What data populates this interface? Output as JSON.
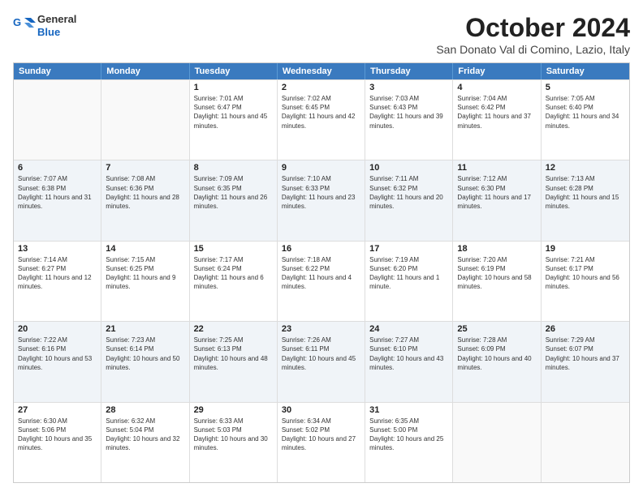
{
  "header": {
    "logo_line1": "General",
    "logo_line2": "Blue",
    "month": "October 2024",
    "location": "San Donato Val di Comino, Lazio, Italy"
  },
  "days_of_week": [
    "Sunday",
    "Monday",
    "Tuesday",
    "Wednesday",
    "Thursday",
    "Friday",
    "Saturday"
  ],
  "weeks": [
    [
      {
        "day": "",
        "empty": true
      },
      {
        "day": "",
        "empty": true
      },
      {
        "day": "1",
        "info": "Sunrise: 7:01 AM\nSunset: 6:47 PM\nDaylight: 11 hours and 45 minutes."
      },
      {
        "day": "2",
        "info": "Sunrise: 7:02 AM\nSunset: 6:45 PM\nDaylight: 11 hours and 42 minutes."
      },
      {
        "day": "3",
        "info": "Sunrise: 7:03 AM\nSunset: 6:43 PM\nDaylight: 11 hours and 39 minutes."
      },
      {
        "day": "4",
        "info": "Sunrise: 7:04 AM\nSunset: 6:42 PM\nDaylight: 11 hours and 37 minutes."
      },
      {
        "day": "5",
        "info": "Sunrise: 7:05 AM\nSunset: 6:40 PM\nDaylight: 11 hours and 34 minutes."
      }
    ],
    [
      {
        "day": "6",
        "info": "Sunrise: 7:07 AM\nSunset: 6:38 PM\nDaylight: 11 hours and 31 minutes."
      },
      {
        "day": "7",
        "info": "Sunrise: 7:08 AM\nSunset: 6:36 PM\nDaylight: 11 hours and 28 minutes."
      },
      {
        "day": "8",
        "info": "Sunrise: 7:09 AM\nSunset: 6:35 PM\nDaylight: 11 hours and 26 minutes."
      },
      {
        "day": "9",
        "info": "Sunrise: 7:10 AM\nSunset: 6:33 PM\nDaylight: 11 hours and 23 minutes."
      },
      {
        "day": "10",
        "info": "Sunrise: 7:11 AM\nSunset: 6:32 PM\nDaylight: 11 hours and 20 minutes."
      },
      {
        "day": "11",
        "info": "Sunrise: 7:12 AM\nSunset: 6:30 PM\nDaylight: 11 hours and 17 minutes."
      },
      {
        "day": "12",
        "info": "Sunrise: 7:13 AM\nSunset: 6:28 PM\nDaylight: 11 hours and 15 minutes."
      }
    ],
    [
      {
        "day": "13",
        "info": "Sunrise: 7:14 AM\nSunset: 6:27 PM\nDaylight: 11 hours and 12 minutes."
      },
      {
        "day": "14",
        "info": "Sunrise: 7:15 AM\nSunset: 6:25 PM\nDaylight: 11 hours and 9 minutes."
      },
      {
        "day": "15",
        "info": "Sunrise: 7:17 AM\nSunset: 6:24 PM\nDaylight: 11 hours and 6 minutes."
      },
      {
        "day": "16",
        "info": "Sunrise: 7:18 AM\nSunset: 6:22 PM\nDaylight: 11 hours and 4 minutes."
      },
      {
        "day": "17",
        "info": "Sunrise: 7:19 AM\nSunset: 6:20 PM\nDaylight: 11 hours and 1 minute."
      },
      {
        "day": "18",
        "info": "Sunrise: 7:20 AM\nSunset: 6:19 PM\nDaylight: 10 hours and 58 minutes."
      },
      {
        "day": "19",
        "info": "Sunrise: 7:21 AM\nSunset: 6:17 PM\nDaylight: 10 hours and 56 minutes."
      }
    ],
    [
      {
        "day": "20",
        "info": "Sunrise: 7:22 AM\nSunset: 6:16 PM\nDaylight: 10 hours and 53 minutes."
      },
      {
        "day": "21",
        "info": "Sunrise: 7:23 AM\nSunset: 6:14 PM\nDaylight: 10 hours and 50 minutes."
      },
      {
        "day": "22",
        "info": "Sunrise: 7:25 AM\nSunset: 6:13 PM\nDaylight: 10 hours and 48 minutes."
      },
      {
        "day": "23",
        "info": "Sunrise: 7:26 AM\nSunset: 6:11 PM\nDaylight: 10 hours and 45 minutes."
      },
      {
        "day": "24",
        "info": "Sunrise: 7:27 AM\nSunset: 6:10 PM\nDaylight: 10 hours and 43 minutes."
      },
      {
        "day": "25",
        "info": "Sunrise: 7:28 AM\nSunset: 6:09 PM\nDaylight: 10 hours and 40 minutes."
      },
      {
        "day": "26",
        "info": "Sunrise: 7:29 AM\nSunset: 6:07 PM\nDaylight: 10 hours and 37 minutes."
      }
    ],
    [
      {
        "day": "27",
        "info": "Sunrise: 6:30 AM\nSunset: 5:06 PM\nDaylight: 10 hours and 35 minutes."
      },
      {
        "day": "28",
        "info": "Sunrise: 6:32 AM\nSunset: 5:04 PM\nDaylight: 10 hours and 32 minutes."
      },
      {
        "day": "29",
        "info": "Sunrise: 6:33 AM\nSunset: 5:03 PM\nDaylight: 10 hours and 30 minutes."
      },
      {
        "day": "30",
        "info": "Sunrise: 6:34 AM\nSunset: 5:02 PM\nDaylight: 10 hours and 27 minutes."
      },
      {
        "day": "31",
        "info": "Sunrise: 6:35 AM\nSunset: 5:00 PM\nDaylight: 10 hours and 25 minutes."
      },
      {
        "day": "",
        "empty": true
      },
      {
        "day": "",
        "empty": true
      }
    ]
  ]
}
